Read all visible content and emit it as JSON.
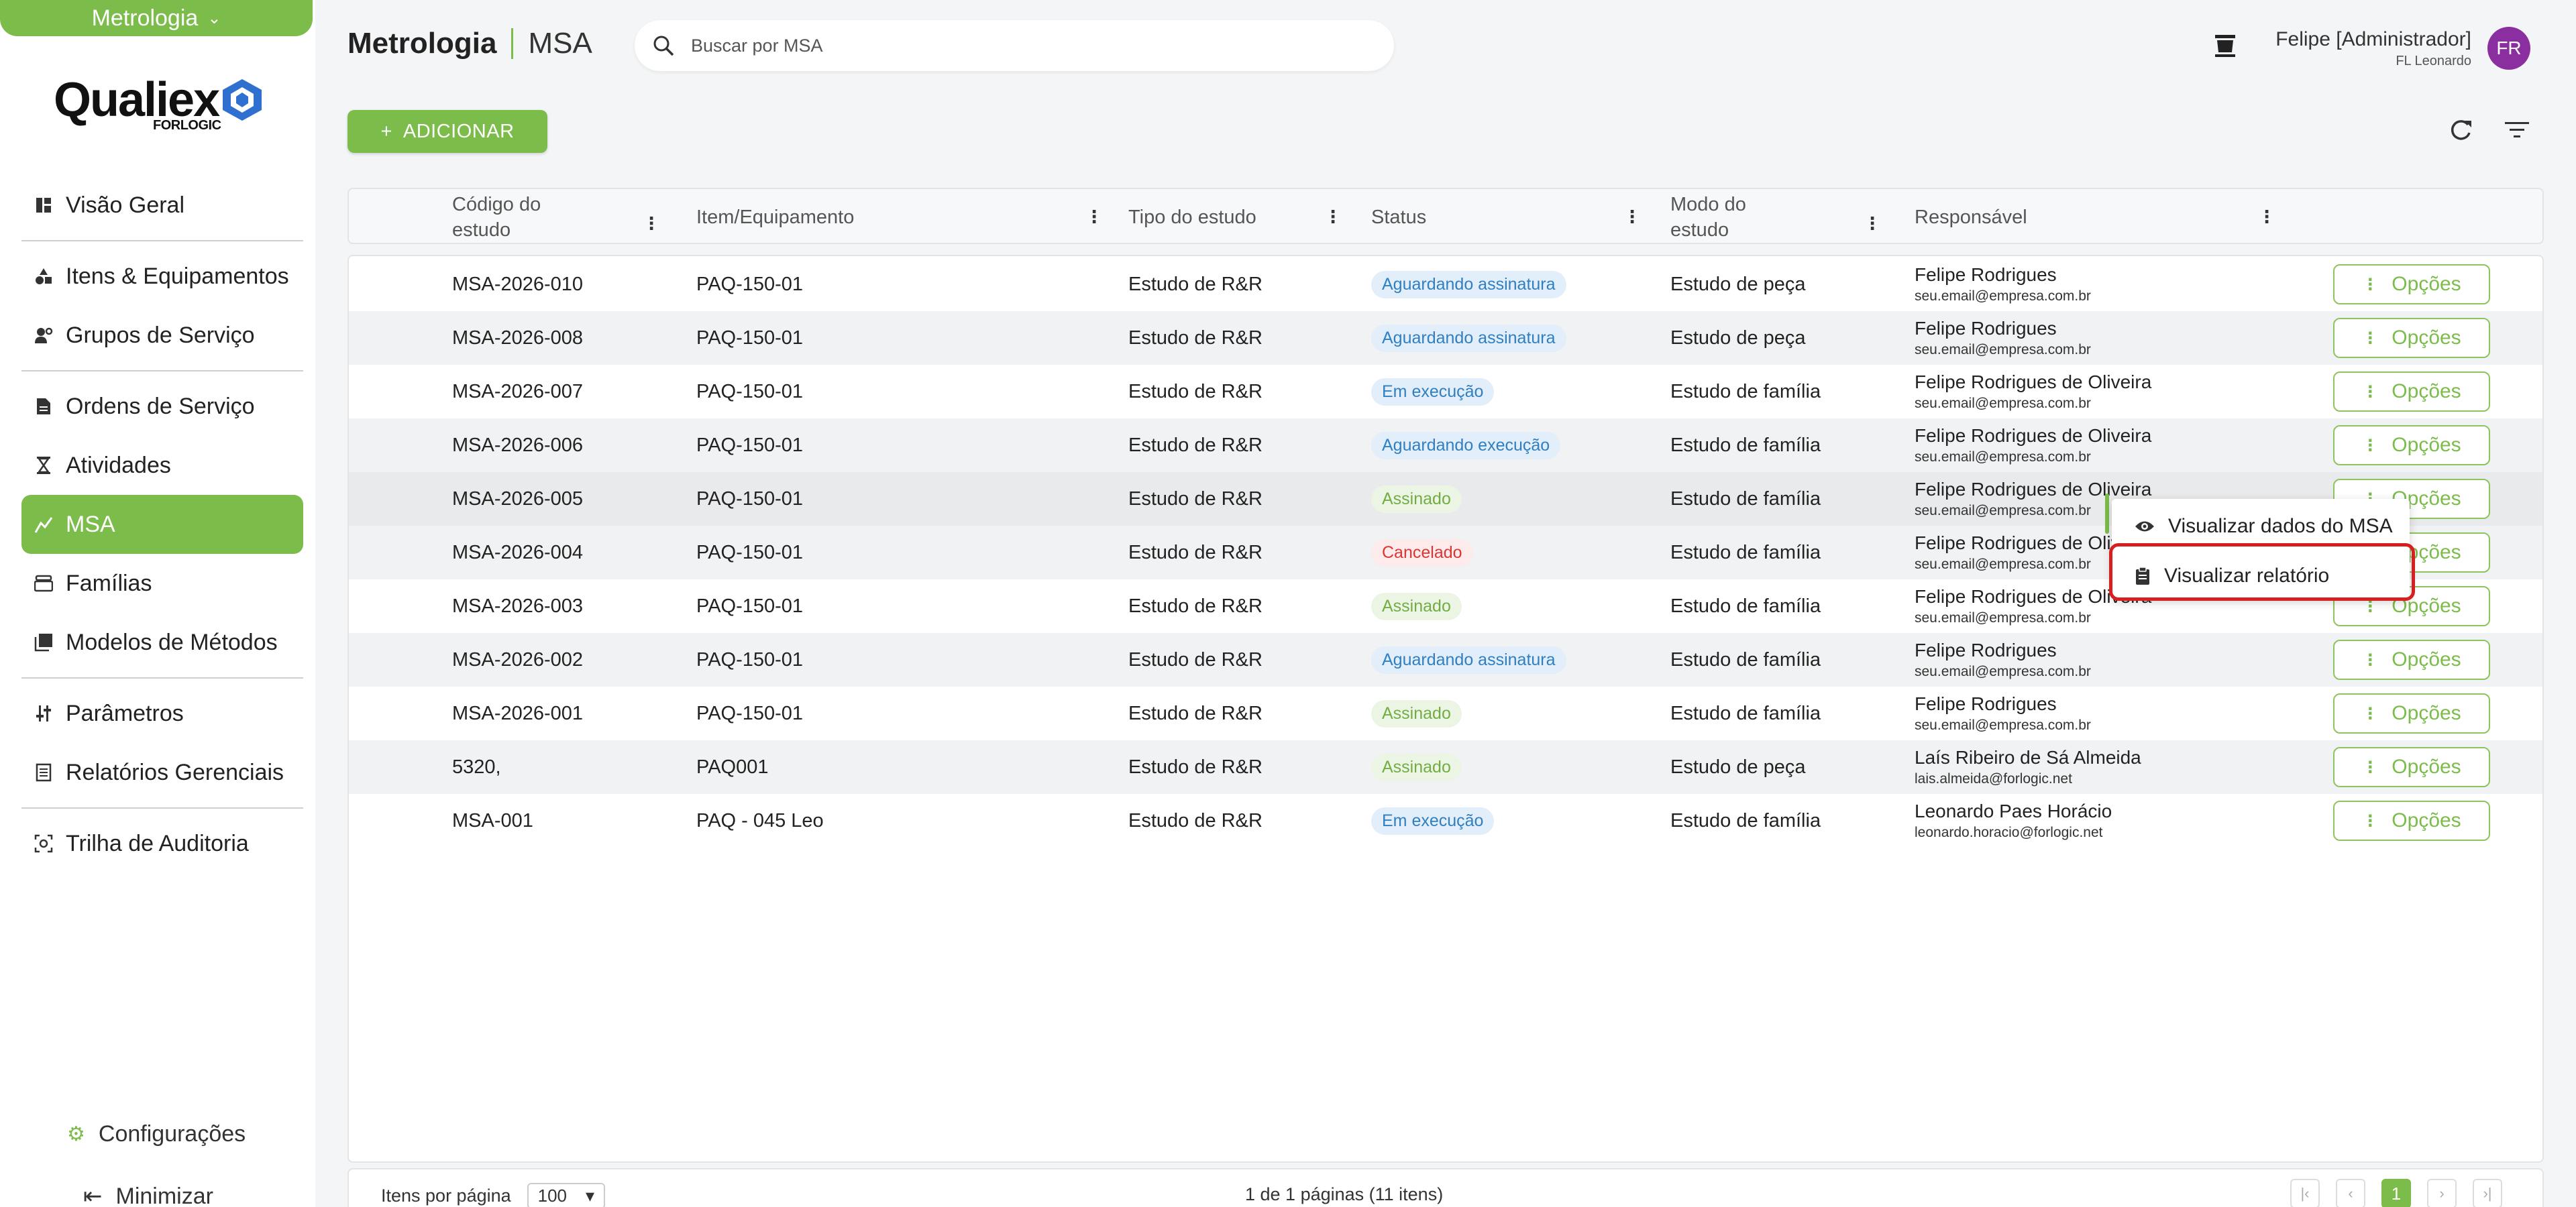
{
  "sidebar": {
    "module": "Metrologia",
    "logo": {
      "word": "Qualiex",
      "sub": "FORLOGIC"
    },
    "items": [
      {
        "label": "Visão Geral",
        "icon": "dashboard-icon"
      },
      {
        "label": "Itens & Equipamentos",
        "icon": "shapes-icon"
      },
      {
        "label": "Grupos de Serviço",
        "icon": "people-gear-icon"
      },
      {
        "label": "Ordens de Serviço",
        "icon": "document-icon"
      },
      {
        "label": "Atividades",
        "icon": "hourglass-icon"
      },
      {
        "label": "MSA",
        "icon": "chart-icon"
      },
      {
        "label": "Famílias",
        "icon": "folder-stack-icon"
      },
      {
        "label": "Modelos de Métodos",
        "icon": "library-icon"
      },
      {
        "label": "Parâmetros",
        "icon": "sliders-icon"
      },
      {
        "label": "Relatórios Gerenciais",
        "icon": "report-icon"
      },
      {
        "label": "Trilha de Auditoria",
        "icon": "audit-icon"
      }
    ],
    "config": "Configurações",
    "minimize": "Minimizar"
  },
  "header": {
    "module": "Metrologia",
    "page": "MSA",
    "search_placeholder": "Buscar por MSA",
    "user_name": "Felipe [Administrador]",
    "user_org": "FL Leonardo",
    "avatar": "FR"
  },
  "toolbar": {
    "add_label": "ADICIONAR"
  },
  "table": {
    "columns": [
      "Código do estudo",
      "Item/Equipamento",
      "Tipo do estudo",
      "Status",
      "Modo do estudo",
      "Responsável"
    ],
    "options_label": "Opções",
    "rows": [
      {
        "code": "MSA-2026-010",
        "item": "PAQ-150-01",
        "type": "Estudo de R&R",
        "status": "Aguardando assinatura",
        "status_color": "blue",
        "mode": "Estudo de peça",
        "resp_name": "Felipe Rodrigues",
        "resp_email": "seu.email@empresa.com.br"
      },
      {
        "code": "MSA-2026-008",
        "item": "PAQ-150-01",
        "type": "Estudo de R&R",
        "status": "Aguardando assinatura",
        "status_color": "blue",
        "mode": "Estudo de peça",
        "resp_name": "Felipe Rodrigues",
        "resp_email": "seu.email@empresa.com.br"
      },
      {
        "code": "MSA-2026-007",
        "item": "PAQ-150-01",
        "type": "Estudo de R&R",
        "status": "Em execução",
        "status_color": "blue",
        "mode": "Estudo de família",
        "resp_name": "Felipe Rodrigues de Oliveira",
        "resp_email": "seu.email@empresa.com.br"
      },
      {
        "code": "MSA-2026-006",
        "item": "PAQ-150-01",
        "type": "Estudo de R&R",
        "status": "Aguardando execução",
        "status_color": "blue",
        "mode": "Estudo de família",
        "resp_name": "Felipe Rodrigues de Oliveira",
        "resp_email": "seu.email@empresa.com.br"
      },
      {
        "code": "MSA-2026-005",
        "item": "PAQ-150-01",
        "type": "Estudo de R&R",
        "status": "Assinado",
        "status_color": "green",
        "mode": "Estudo de família",
        "resp_name": "Felipe Rodrigues de Oliveira",
        "resp_email": "seu.email@empresa.com.br"
      },
      {
        "code": "MSA-2026-004",
        "item": "PAQ-150-01",
        "type": "Estudo de R&R",
        "status": "Cancelado",
        "status_color": "red",
        "mode": "Estudo de família",
        "resp_name": "Felipe Rodrigues de Oliveira",
        "resp_email": "seu.email@empresa.com.br"
      },
      {
        "code": "MSA-2026-003",
        "item": "PAQ-150-01",
        "type": "Estudo de R&R",
        "status": "Assinado",
        "status_color": "green",
        "mode": "Estudo de família",
        "resp_name": "Felipe Rodrigues de Oliveira",
        "resp_email": "seu.email@empresa.com.br"
      },
      {
        "code": "MSA-2026-002",
        "item": "PAQ-150-01",
        "type": "Estudo de R&R",
        "status": "Aguardando assinatura",
        "status_color": "blue",
        "mode": "Estudo de família",
        "resp_name": "Felipe Rodrigues",
        "resp_email": "seu.email@empresa.com.br"
      },
      {
        "code": "MSA-2026-001",
        "item": "PAQ-150-01",
        "type": "Estudo de R&R",
        "status": "Assinado",
        "status_color": "green",
        "mode": "Estudo de família",
        "resp_name": "Felipe Rodrigues",
        "resp_email": "seu.email@empresa.com.br"
      },
      {
        "code": "5320,",
        "item": "PAQ001",
        "type": "Estudo de R&R",
        "status": "Assinado",
        "status_color": "green",
        "mode": "Estudo de peça",
        "resp_name": "Laís Ribeiro de Sá Almeida",
        "resp_email": "lais.almeida@forlogic.net"
      },
      {
        "code": "MSA-001",
        "item": "PAQ - 045 Leo",
        "type": "Estudo de R&R",
        "status": "Em execução",
        "status_color": "blue",
        "mode": "Estudo de família",
        "resp_name": "Leonardo Paes Horácio",
        "resp_email": "leonardo.horacio@forlogic.net"
      }
    ]
  },
  "context_menu": {
    "items": [
      {
        "label": "Visualizar dados do MSA",
        "icon": "eye-icon"
      },
      {
        "label": "Visualizar relatório",
        "icon": "clipboard-icon"
      }
    ]
  },
  "footer": {
    "items_per_page_label": "Itens por página",
    "items_per_page": "100",
    "page_info": "1 de 1 páginas (11 itens)",
    "current_page": "1"
  },
  "colors": {
    "brand": "#7cbc4a",
    "highlight": "#d81f1f",
    "avatar": "#8b2fa0"
  }
}
